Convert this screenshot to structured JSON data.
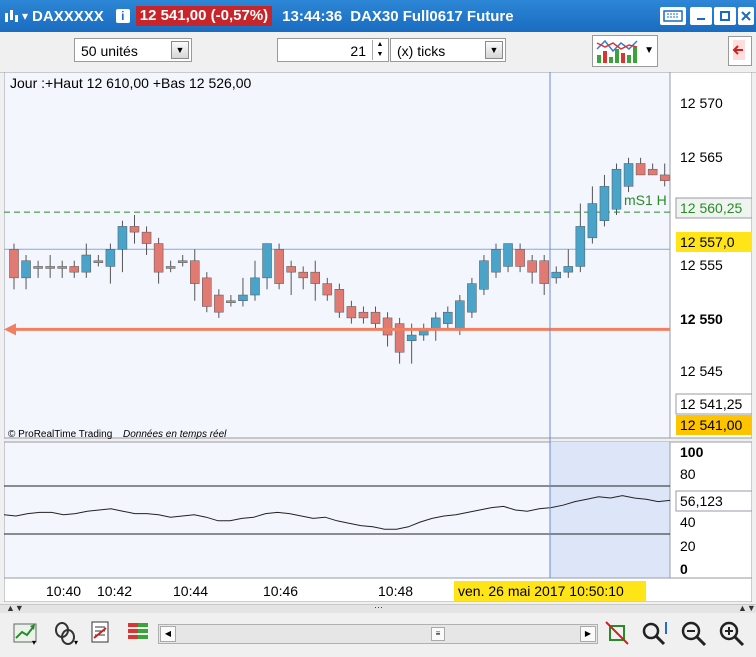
{
  "titlebar": {
    "symbol": "DAXXXXX",
    "info_badge": "i",
    "price": "12 541,00 (-0,57%)",
    "time": "13:44:36",
    "instrument": "DAX30 Full0617 Future",
    "dropdown_glyph": "▾"
  },
  "toolbar": {
    "units_value": "50 unités",
    "ticks_value": "21",
    "ticks_unit": "(x) ticks"
  },
  "chart_info": "Jour :+Haut 12 610,00 +Bas 12 526,00",
  "watermark_brand": "© ProRealTime Trading",
  "watermark_note": "Données en temps réel",
  "level_label": "mS1 H",
  "price_labels": [
    "12 570",
    "12 565",
    "12 560,25",
    "12 557,0",
    "12 555",
    "12 550",
    "12 545",
    "12 541,25",
    "12 541,00"
  ],
  "osc_labels": [
    "100",
    "80",
    "56,123",
    "40",
    "20",
    "0"
  ],
  "time_labels": [
    "10:40",
    "10:42",
    "10:44",
    "10:46",
    "10:48"
  ],
  "cursor_time": "ven. 26 mai 2017 10:50:10",
  "colors": {
    "up": "#4aa3c8",
    "down": "#e07a72",
    "doji": "#999999",
    "arrow": "#f08060",
    "background": "#f4f6fd",
    "level_green": "#2a8a2a",
    "highlight": "#ffe418",
    "titlebar": "#1a6cc0"
  },
  "chart_data": {
    "type": "candlestick",
    "xlabel": "",
    "ylabel": "",
    "ylim": [
      12540.5,
      12572.5
    ],
    "y_ticks": [
      12570,
      12565,
      12555,
      12550,
      12545
    ],
    "reference_lines": [
      {
        "label": "12 560,25",
        "value": 12560.25,
        "style": "dashed"
      },
      {
        "label": "12 557,0",
        "value": 12557.0,
        "style": "solid"
      },
      {
        "label": "12 550",
        "value": 12550.0,
        "style": "arrow"
      },
      {
        "label": "12 541,25",
        "value": 12541.25
      },
      {
        "label": "12 541,00",
        "value": 12541.0
      }
    ],
    "candles": [
      {
        "o": 12557.0,
        "h": 12557.5,
        "l": 12553.5,
        "c": 12554.5
      },
      {
        "o": 12554.5,
        "h": 12556.5,
        "l": 12553.5,
        "c": 12556.0
      },
      {
        "o": 12555.5,
        "h": 12556.0,
        "l": 12554.5,
        "c": 12555.5
      },
      {
        "o": 12555.5,
        "h": 12556.5,
        "l": 12554.5,
        "c": 12555.5
      },
      {
        "o": 12555.5,
        "h": 12556.0,
        "l": 12554.5,
        "c": 12555.5
      },
      {
        "o": 12555.5,
        "h": 12556.0,
        "l": 12554.5,
        "c": 12555.0
      },
      {
        "o": 12555.0,
        "h": 12557.5,
        "l": 12554.5,
        "c": 12556.5
      },
      {
        "o": 12556.0,
        "h": 12556.5,
        "l": 12555.5,
        "c": 12556.0
      },
      {
        "o": 12555.5,
        "h": 12557.5,
        "l": 12554.0,
        "c": 12557.0
      },
      {
        "o": 12557.0,
        "h": 12559.5,
        "l": 12555.0,
        "c": 12559.0
      },
      {
        "o": 12559.0,
        "h": 12560.0,
        "l": 12557.5,
        "c": 12558.5
      },
      {
        "o": 12558.5,
        "h": 12559.0,
        "l": 12556.5,
        "c": 12557.5
      },
      {
        "o": 12557.5,
        "h": 12558.0,
        "l": 12554.0,
        "c": 12555.0
      },
      {
        "o": 12555.5,
        "h": 12556.0,
        "l": 12555.0,
        "c": 12555.5
      },
      {
        "o": 12556.0,
        "h": 12556.5,
        "l": 12555.5,
        "c": 12556.0
      },
      {
        "o": 12556.0,
        "h": 12557.0,
        "l": 12552.5,
        "c": 12554.0
      },
      {
        "o": 12554.5,
        "h": 12555.0,
        "l": 12551.5,
        "c": 12552.0
      },
      {
        "o": 12553.0,
        "h": 12553.5,
        "l": 12551.0,
        "c": 12551.5
      },
      {
        "o": 12552.5,
        "h": 12553.0,
        "l": 12552.0,
        "c": 12552.5
      },
      {
        "o": 12552.5,
        "h": 12554.5,
        "l": 12552.0,
        "c": 12553.0
      },
      {
        "o": 12553.0,
        "h": 12556.0,
        "l": 12552.5,
        "c": 12554.5
      },
      {
        "o": 12554.5,
        "h": 12557.5,
        "l": 12553.5,
        "c": 12557.5
      },
      {
        "o": 12557.0,
        "h": 12557.5,
        "l": 12553.5,
        "c": 12554.0
      },
      {
        "o": 12555.5,
        "h": 12556.0,
        "l": 12553.0,
        "c": 12555.0
      },
      {
        "o": 12555.0,
        "h": 12555.5,
        "l": 12553.5,
        "c": 12554.5
      },
      {
        "o": 12555.0,
        "h": 12556.0,
        "l": 12552.5,
        "c": 12554.0
      },
      {
        "o": 12554.0,
        "h": 12554.5,
        "l": 12552.5,
        "c": 12553.0
      },
      {
        "o": 12553.5,
        "h": 12554.0,
        "l": 12551.0,
        "c": 12551.5
      },
      {
        "o": 12552.0,
        "h": 12552.5,
        "l": 12550.5,
        "c": 12551.0
      },
      {
        "o": 12551.5,
        "h": 12552.0,
        "l": 12550.5,
        "c": 12551.0
      },
      {
        "o": 12551.5,
        "h": 12552.0,
        "l": 12550.0,
        "c": 12550.5
      },
      {
        "o": 12551.0,
        "h": 12551.5,
        "l": 12548.5,
        "c": 12549.5
      },
      {
        "o": 12550.5,
        "h": 12551.0,
        "l": 12547.0,
        "c": 12548.0
      },
      {
        "o": 12549.0,
        "h": 12550.5,
        "l": 12547.0,
        "c": 12549.5
      },
      {
        "o": 12549.5,
        "h": 12550.5,
        "l": 12549.0,
        "c": 12550.0
      },
      {
        "o": 12550.0,
        "h": 12551.5,
        "l": 12549.0,
        "c": 12551.0
      },
      {
        "o": 12550.5,
        "h": 12552.0,
        "l": 12550.0,
        "c": 12551.5
      },
      {
        "o": 12550.0,
        "h": 12553.0,
        "l": 12549.5,
        "c": 12552.5
      },
      {
        "o": 12551.5,
        "h": 12554.5,
        "l": 12551.0,
        "c": 12554.0
      },
      {
        "o": 12553.5,
        "h": 12556.5,
        "l": 12553.0,
        "c": 12556.0
      },
      {
        "o": 12555.0,
        "h": 12557.5,
        "l": 12554.5,
        "c": 12557.0
      },
      {
        "o": 12555.5,
        "h": 12557.5,
        "l": 12555.0,
        "c": 12557.5
      },
      {
        "o": 12557.0,
        "h": 12557.5,
        "l": 12555.0,
        "c": 12555.5
      },
      {
        "o": 12556.0,
        "h": 12556.5,
        "l": 12554.0,
        "c": 12555.0
      },
      {
        "o": 12556.0,
        "h": 12556.5,
        "l": 12553.0,
        "c": 12554.0
      },
      {
        "o": 12554.5,
        "h": 12555.5,
        "l": 12554.0,
        "c": 12555.0
      },
      {
        "o": 12555.0,
        "h": 12557.0,
        "l": 12554.5,
        "c": 12555.5
      },
      {
        "o": 12555.5,
        "h": 12561.0,
        "l": 12555.0,
        "c": 12559.0
      },
      {
        "o": 12558.0,
        "h": 12562.5,
        "l": 12557.5,
        "c": 12561.0
      },
      {
        "o": 12559.5,
        "h": 12563.5,
        "l": 12559.0,
        "c": 12562.5
      },
      {
        "o": 12560.5,
        "h": 12564.5,
        "l": 12560.0,
        "c": 12564.0
      },
      {
        "o": 12562.5,
        "h": 12565.0,
        "l": 12562.0,
        "c": 12564.5
      },
      {
        "o": 12564.5,
        "h": 12565.0,
        "l": 12563.5,
        "c": 12563.5
      },
      {
        "o": 12564.0,
        "h": 12564.5,
        "l": 12563.5,
        "c": 12563.5
      },
      {
        "o": 12563.5,
        "h": 12564.5,
        "l": 12562.5,
        "c": 12563.0
      }
    ],
    "oscillator": {
      "ylim": [
        0,
        100
      ],
      "y_ticks": [
        100,
        80,
        60,
        40,
        20,
        0
      ],
      "levels": [
        70,
        30
      ],
      "last_value": 56.123,
      "values": [
        46,
        45,
        47,
        48,
        48,
        46,
        47,
        49,
        50,
        51,
        49,
        47,
        47,
        46,
        44,
        45,
        46,
        44,
        41,
        41,
        43,
        44,
        47,
        48,
        47,
        45,
        43,
        44,
        41,
        39,
        37,
        36,
        34,
        34,
        36,
        40,
        43,
        45,
        46,
        48,
        50,
        52,
        53,
        50,
        49,
        51,
        52,
        54,
        57,
        59,
        61,
        60,
        62,
        60,
        59,
        57,
        58
      ]
    },
    "x_tick_labels": [
      "10:40",
      "10:42",
      "10:44",
      "10:46",
      "10:48"
    ]
  }
}
